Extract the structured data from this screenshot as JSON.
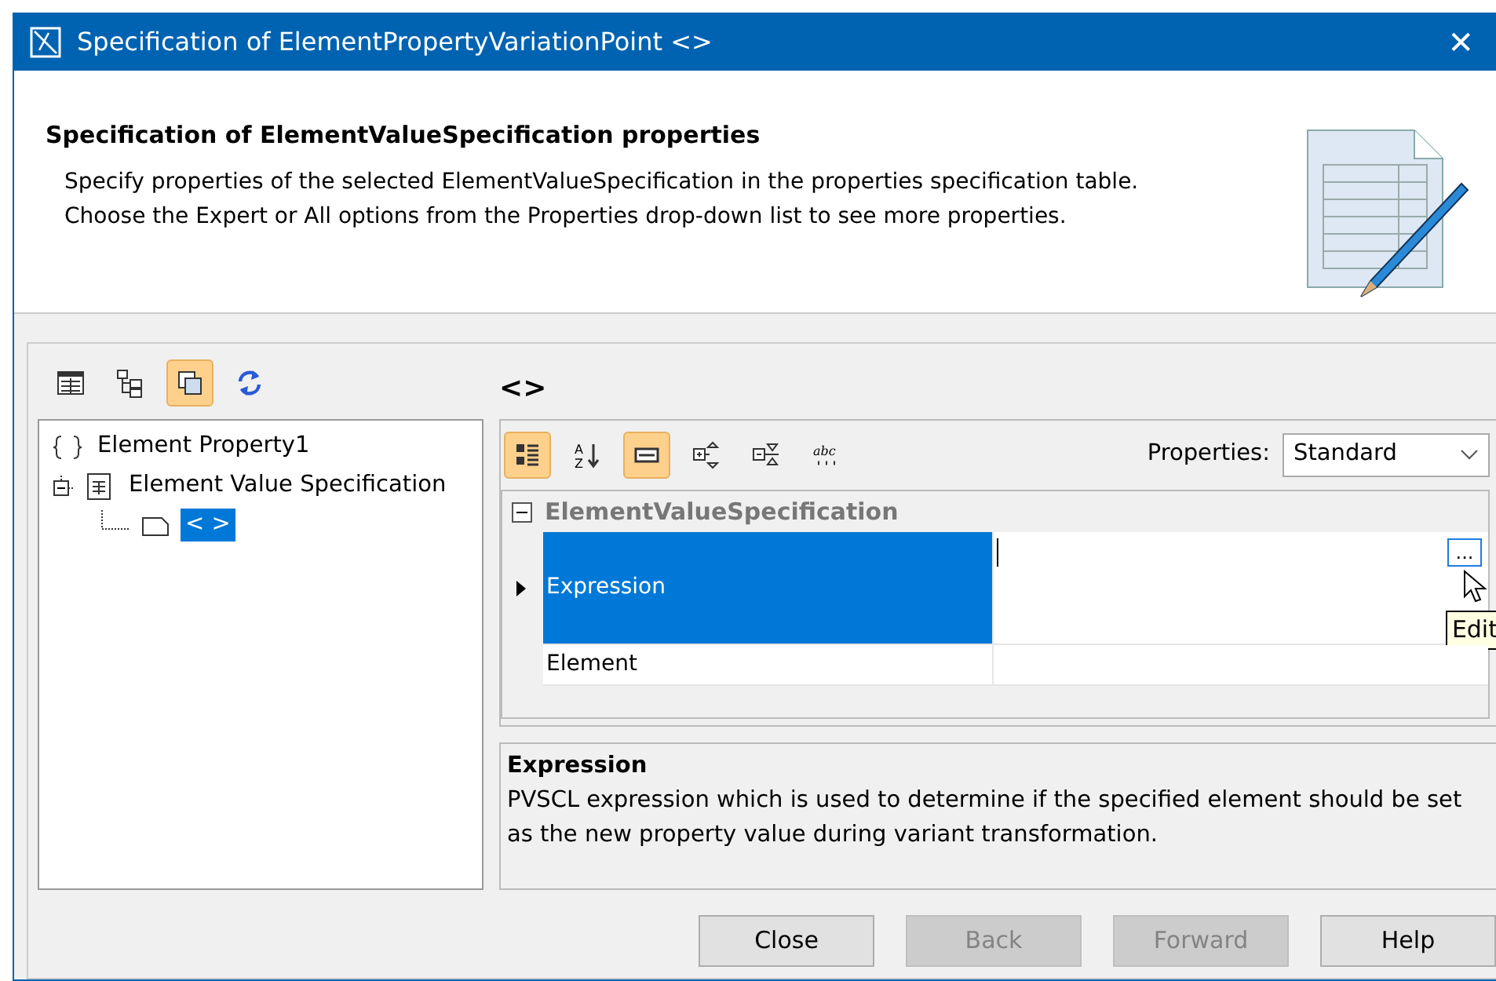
{
  "window": {
    "title": "Specification of ElementPropertyVariationPoint <>",
    "close_glyph": "✕"
  },
  "header": {
    "title": "Specification of ElementValueSpecification properties",
    "lines": [
      "Specify properties of the selected ElementValueSpecification in the properties specification table.",
      "Choose the Expert or All options from the Properties drop-down list to see more properties."
    ]
  },
  "left_toolbar": [
    {
      "kind": "table",
      "selected": false
    },
    {
      "kind": "tree",
      "selected": false
    },
    {
      "kind": "copy",
      "selected": true
    },
    {
      "kind": "refresh",
      "selected": false
    }
  ],
  "tree": [
    {
      "label": "Element Property1",
      "kind": "braces",
      "selected": false
    },
    {
      "label": "Element Value Specification",
      "kind": "doc",
      "selected": false,
      "expanded": true,
      "children": [
        {
          "label": "< >",
          "kind": "note",
          "selected": true
        }
      ]
    }
  ],
  "element_title": "<>",
  "right_toolbar": [
    {
      "kind": "categorized",
      "selected": true
    },
    {
      "kind": "sort",
      "selected": false,
      "letters": [
        "A",
        "Z"
      ]
    },
    {
      "kind": "compact",
      "selected": true
    },
    {
      "kind": "expand",
      "selected": false
    },
    {
      "kind": "collapse",
      "selected": false
    },
    {
      "kind": "abc",
      "selected": false,
      "letters": [
        "abc"
      ]
    }
  ],
  "properties_dropdown": {
    "label": "Properties:",
    "value": "Standard"
  },
  "group": {
    "title": "ElementValueSpecification",
    "expanded": true
  },
  "rows": [
    {
      "name": "Expression",
      "value": "",
      "selected": true,
      "editing": true
    },
    {
      "name": "Element",
      "value": "",
      "selected": false,
      "editing": false
    }
  ],
  "edit_button": "...",
  "tooltip": "Edit",
  "description": {
    "title": "Expression",
    "text": "PVSCL expression which is used to determine if the specified element should be set as the new property value during variant transformation."
  },
  "buttons": [
    {
      "label": "Close",
      "disabled": false
    },
    {
      "label": "Back",
      "disabled": true
    },
    {
      "label": "Forward",
      "disabled": true
    },
    {
      "label": "Help",
      "disabled": false
    }
  ]
}
